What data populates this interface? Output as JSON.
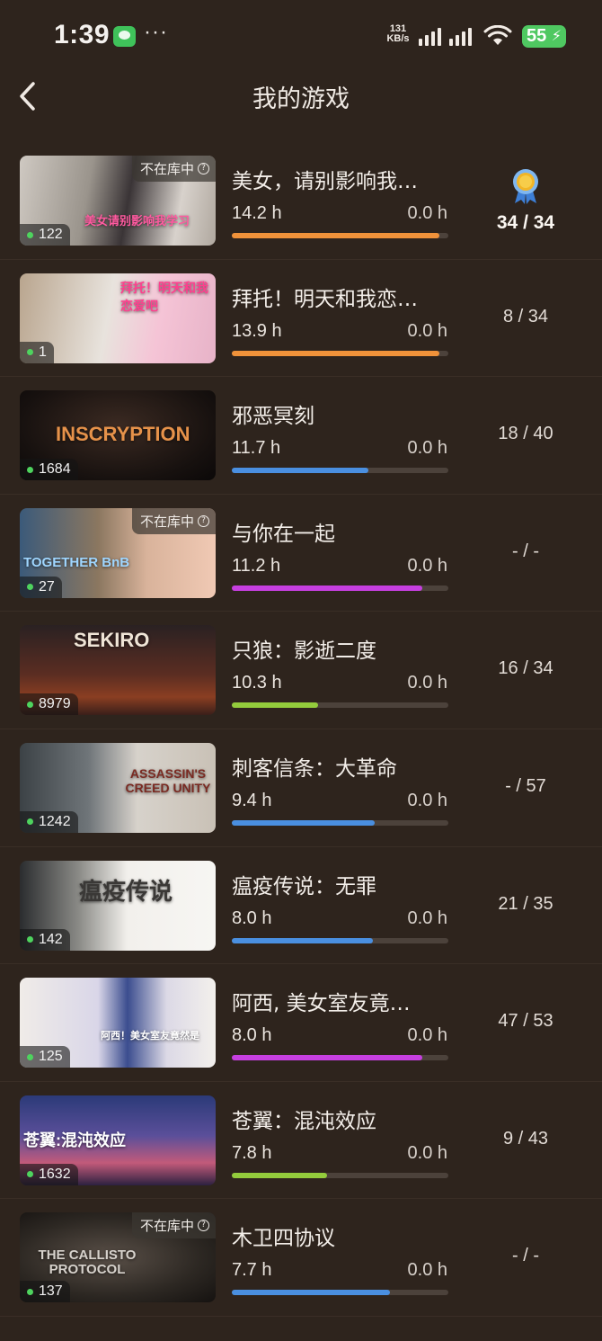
{
  "status_bar": {
    "time": "1:39",
    "more": "···",
    "net_speed_value": "131",
    "net_speed_unit": "KB/s",
    "battery": "55"
  },
  "header": {
    "title": "我的游戏"
  },
  "not_in_library_label": "不在库中",
  "games": [
    {
      "name": "美女，请别影响我…",
      "cover_text": "美女请别影响我学习",
      "total": "14.2 h",
      "recent": "0.0 h",
      "progress": 0.96,
      "bar_color": "#f0923a",
      "ach": "34 / 34",
      "perfect": true,
      "in_library": false,
      "players": "122",
      "cover_style": "linear-gradient(100deg,#cfc9c2 0%,#9a948c 35%,#3a3436 55%,#d8d2cc 80%,#b0a89f 100%)",
      "cover_text_color": "#ff5aa0"
    },
    {
      "name": "拜托！明天和我恋…",
      "cover_text": "拜托！明天和我恋爱吧",
      "total": "13.9 h",
      "recent": "0.0 h",
      "progress": 0.96,
      "bar_color": "#f0923a",
      "ach": "8 / 34",
      "perfect": false,
      "in_library": true,
      "players": "1",
      "cover_style": "linear-gradient(100deg,#b9a58e 0%,#e8e3dd 45%,#f5c4d6 70%,#e7b3c8 100%)",
      "cover_text_color": "#ff3f8e"
    },
    {
      "name": "邪恶冥刻",
      "cover_text": "INSCRYPTION",
      "total": "11.7 h",
      "recent": "0.0 h",
      "progress": 0.63,
      "bar_color": "#4a8fe0",
      "ach": "18 / 40",
      "perfect": false,
      "in_library": true,
      "players": "1684",
      "cover_style": "radial-gradient(ellipse at 50% 40%,#3b2a22 0%,#17110f 70%,#0b0808 100%)",
      "cover_text_color": "#e6924a"
    },
    {
      "name": "与你在一起",
      "cover_text": "TOGETHER BnB",
      "total": "11.2 h",
      "recent": "0.0 h",
      "progress": 0.88,
      "bar_color": "#c63fe0",
      "ach": "- / -",
      "perfect": false,
      "in_library": false,
      "players": "27",
      "cover_style": "linear-gradient(90deg,#3b5a7a 0%,#8b7760 40%,#d9b39b 65%,#f0c9b4 100%)",
      "cover_text_color": "#9fd6ff"
    },
    {
      "name": "只狼：影逝二度",
      "cover_text": "SEKIRO",
      "total": "10.3 h",
      "recent": "0.0 h",
      "progress": 0.4,
      "bar_color": "#93cc3c",
      "ach": "16 / 34",
      "perfect": false,
      "in_library": true,
      "players": "8979",
      "cover_style": "linear-gradient(180deg,#2a2122 0%,#5b2d22 55%,#8a3e22 80%,#3a1f1a 100%)",
      "cover_text_color": "#efe4d6"
    },
    {
      "name": "刺客信条：大革命",
      "cover_text": "ASSASSIN'S CREED UNITY",
      "total": "9.4 h",
      "recent": "0.0 h",
      "progress": 0.66,
      "bar_color": "#4a8fe0",
      "ach": "- / 57",
      "perfect": false,
      "in_library": true,
      "players": "1242",
      "cover_style": "linear-gradient(90deg,#3c4246 0%,#6f7579 35%,#d7d2cb 60%,#c9c1b6 100%)",
      "cover_text_color": "#7a2a22"
    },
    {
      "name": "瘟疫传说：无罪",
      "cover_text": "瘟疫传说",
      "total": "8.0 h",
      "recent": "0.0 h",
      "progress": 0.65,
      "bar_color": "#4a8fe0",
      "ach": "21 / 35",
      "perfect": false,
      "in_library": true,
      "players": "142",
      "cover_style": "linear-gradient(90deg,#2b2d2f 0%,#8a8a86 30%,#f2f0ec 55%,#f7f6f3 100%)",
      "cover_text_color": "#3a3836"
    },
    {
      "name": "阿西, 美女室友竟…",
      "cover_text": "阿西！美女室友竟然是",
      "total": "8.0 h",
      "recent": "0.0 h",
      "progress": 0.88,
      "bar_color": "#c63fe0",
      "ach": "47 / 53",
      "perfect": false,
      "in_library": true,
      "players": "125",
      "cover_style": "linear-gradient(90deg,#f0ece8 0%,#d9d6e8 40%,#3b4d8f 55%,#dcd9e6 75%,#f3f0ec 100%)",
      "cover_text_color": "#ffffff"
    },
    {
      "name": "苍翼：混沌效应",
      "cover_text": "苍翼:混沌效应",
      "total": "7.8 h",
      "recent": "0.0 h",
      "progress": 0.44,
      "bar_color": "#93cc3c",
      "ach": "9 / 43",
      "perfect": false,
      "in_library": true,
      "players": "1632",
      "cover_style": "linear-gradient(180deg,#2b3a78 0%,#5b4f9a 45%,#c25a7a 75%,#2c2140 100%)",
      "cover_text_color": "#ffffff"
    },
    {
      "name": "木卫四协议",
      "cover_text": "THE CALLISTO PROTOCOL",
      "total": "7.7 h",
      "recent": "0.0 h",
      "progress": 0.73,
      "bar_color": "#4a8fe0",
      "ach": "- / -",
      "perfect": false,
      "in_library": false,
      "players": "137",
      "cover_style": "radial-gradient(ellipse at 45% 50%,#5a5048 0%,#2d2823 60%,#151210 100%)",
      "cover_text_color": "#d7d2cc"
    }
  ]
}
